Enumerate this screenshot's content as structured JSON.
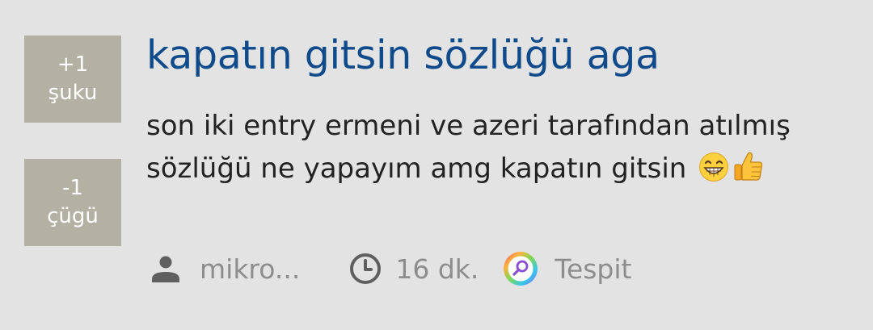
{
  "votes": {
    "up": {
      "count": "+1",
      "label": "şuku"
    },
    "down": {
      "count": "-1",
      "label": "çügü"
    }
  },
  "entry": {
    "title": "kapatın gitsin sözlüğü aga",
    "body_line1": "son iki entry ermeni ve azeri tarafından atılmış",
    "body_line2": "sözlüğü ne yapayım amg kapatın gitsin"
  },
  "meta": {
    "author": "mikro...",
    "time": "16 dk.",
    "badge": "Tespit"
  },
  "icons": {
    "author": "person-icon",
    "time": "clock-icon",
    "badge": "tespit-magnifier-icon",
    "emoji1": "grinning-face-emoji",
    "emoji2": "thumbs-up-emoji"
  },
  "colors": {
    "background": "#e3e3e3",
    "vote_box": "#b2b1a4",
    "title": "#0f4a8a",
    "body_text": "#222222",
    "meta_text": "#8d8d8d"
  }
}
